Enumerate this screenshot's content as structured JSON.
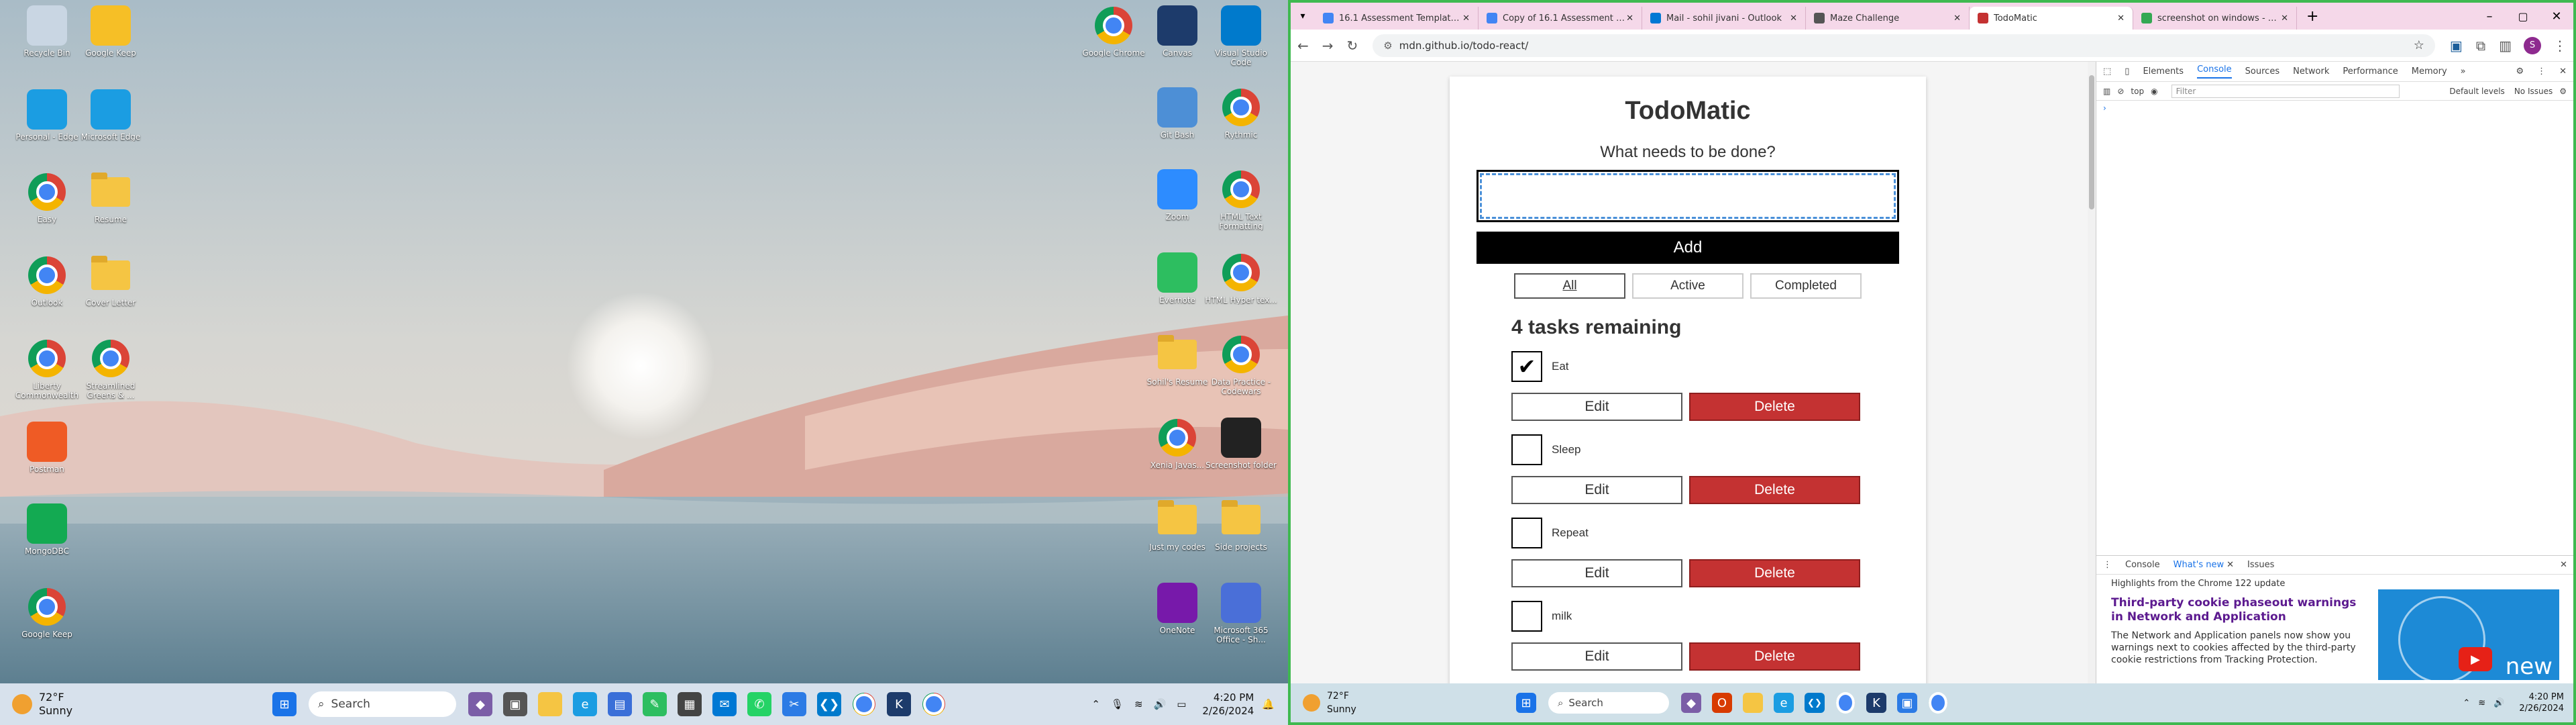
{
  "desktop": {
    "icons_left": [
      {
        "label": "Recycle Bin",
        "kind": "recycle"
      },
      {
        "label": "Google Keep",
        "kind": "keep"
      },
      {
        "label": "Personal - Edge",
        "kind": "edge"
      },
      {
        "label": "Microsoft Edge",
        "kind": "edge"
      },
      {
        "label": "Easy",
        "kind": "chrome"
      },
      {
        "label": "Resume",
        "kind": "folder"
      },
      {
        "label": "Outlook",
        "kind": "chrome"
      },
      {
        "label": "Cover Letter",
        "kind": "folder"
      },
      {
        "label": "Liberty Commonwealth",
        "kind": "chrome"
      },
      {
        "label": "Streamlined Greens & ...",
        "kind": "chrome"
      },
      {
        "label": "Postman",
        "kind": "postman"
      },
      {
        "label": "MongoDBC",
        "kind": "mongo"
      },
      {
        "label": "Google Keep",
        "kind": "chrome"
      }
    ],
    "icons_right": [
      {
        "label": "Google Chrome",
        "kind": "chrome"
      },
      {
        "label": "Canvas",
        "kind": "canvas"
      },
      {
        "label": "Visual Studio Code",
        "kind": "vscode"
      },
      {
        "label": "Git Bash",
        "kind": "git"
      },
      {
        "label": "Rythmic",
        "kind": "chrome"
      },
      {
        "label": "Zoom",
        "kind": "zoom"
      },
      {
        "label": "HTML Text Formatting",
        "kind": "chrome"
      },
      {
        "label": "Evernote",
        "kind": "evernote"
      },
      {
        "label": "HTML Hyper tex...",
        "kind": "chrome"
      },
      {
        "label": "Sohil's Resume",
        "kind": "folder"
      },
      {
        "label": "Data Practice - Codewars",
        "kind": "chrome"
      },
      {
        "label": "Xenia Javas...",
        "kind": "chrome"
      },
      {
        "label": "Screenshot folder",
        "kind": "folder-dark"
      },
      {
        "label": "Just my codes",
        "kind": "folder"
      },
      {
        "label": "Side projects",
        "kind": "folder"
      },
      {
        "label": "OneNote",
        "kind": "onenote"
      },
      {
        "label": "Microsoft 365 Office - Sh...",
        "kind": "m365"
      }
    ]
  },
  "taskbar_left": {
    "weather_temp": "72°F",
    "weather_desc": "Sunny",
    "search_placeholder": "Search",
    "time": "4:20 PM",
    "date": "2/26/2024"
  },
  "browser": {
    "tabs": [
      {
        "title": "16.1 Assessment Template - Go...",
        "color": "#4285f4"
      },
      {
        "title": "Copy of 16.1 Assessment Temp...",
        "color": "#4285f4"
      },
      {
        "title": "Mail - sohil jivani - Outlook",
        "color": "#0078d4"
      },
      {
        "title": "Maze Challenge",
        "color": "#555555"
      },
      {
        "title": "TodoMatic",
        "color": "#c43232"
      },
      {
        "title": "screenshot on windows - Goog...",
        "color": "#34a853"
      }
    ],
    "url": "mdn.github.io/todo-react/"
  },
  "todo": {
    "title": "TodoMatic",
    "prompt": "What needs to be done?",
    "input_value": "",
    "add_label": "Add",
    "filters": [
      "All",
      "Active",
      "Completed"
    ],
    "remaining": "4 tasks remaining",
    "edit_label": "Edit",
    "delete_label": "Delete",
    "tasks": [
      {
        "name": "Eat",
        "checked": "✔"
      },
      {
        "name": "Sleep",
        "checked": ""
      },
      {
        "name": "Repeat",
        "checked": ""
      },
      {
        "name": "milk",
        "checked": ""
      }
    ]
  },
  "devtools": {
    "tabs": [
      "Elements",
      "Console",
      "Sources",
      "Network",
      "Performance",
      "Memory"
    ],
    "context": "top",
    "filter_placeholder": "Filter",
    "levels": "Default levels",
    "issues": "No Issues",
    "drawer_tabs": [
      "Console",
      "What's new",
      "Issues"
    ],
    "highlights": "Highlights from the Chrome 122 update",
    "news_title": "Third-party cookie phaseout warnings in Network and Application",
    "news_body": "The Network and Application panels now show you warnings next to cookies affected by the third-party cookie restrictions from Tracking Protection.",
    "news_img_text": "new"
  },
  "taskbar_right": {
    "weather_temp": "72°F",
    "weather_desc": "Sunny",
    "search_placeholder": "Search",
    "time": "4:20 PM",
    "date": "2/26/2024"
  }
}
